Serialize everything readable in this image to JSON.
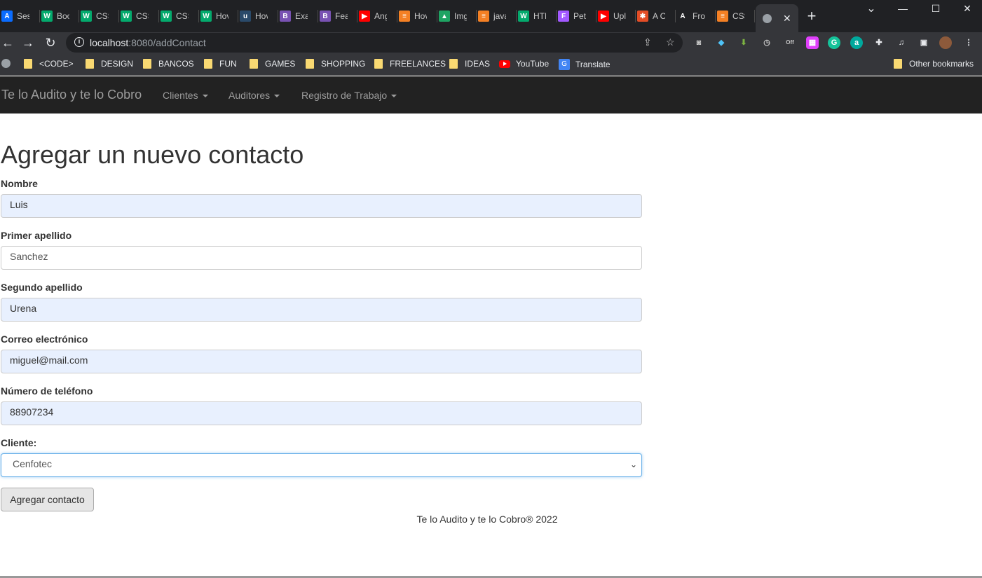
{
  "browser": {
    "tabs": [
      {
        "title": "Ses",
        "icon": "A",
        "color": "#0a6cff"
      },
      {
        "title": "Boo",
        "icon": "W",
        "color": "#04aa6d"
      },
      {
        "title": "CSS",
        "icon": "W",
        "color": "#04aa6d"
      },
      {
        "title": "CSS",
        "icon": "W",
        "color": "#04aa6d"
      },
      {
        "title": "CSS",
        "icon": "W",
        "color": "#04aa6d"
      },
      {
        "title": "Hov",
        "icon": "W",
        "color": "#04aa6d"
      },
      {
        "title": "Hov",
        "icon": "u",
        "color": "#2a4a6a"
      },
      {
        "title": "Exa",
        "icon": "B",
        "color": "#7952b3"
      },
      {
        "title": "Fea",
        "icon": "B",
        "color": "#7952b3"
      },
      {
        "title": "Ang",
        "icon": "▶",
        "color": "#ff0000"
      },
      {
        "title": "Hov",
        "icon": "≡",
        "color": "#f48024"
      },
      {
        "title": "Img",
        "icon": "▲",
        "color": "#1fa463"
      },
      {
        "title": "java",
        "icon": "≡",
        "color": "#f48024"
      },
      {
        "title": "HTM",
        "icon": "W",
        "color": "#04aa6d"
      },
      {
        "title": "Pet",
        "icon": "F",
        "color": "#a259ff"
      },
      {
        "title": "Upl",
        "icon": "▶",
        "color": "#ff0000"
      },
      {
        "title": "A C",
        "icon": "✱",
        "color": "#e44d26"
      },
      {
        "title": "Fro",
        "icon": "A",
        "color": "#202124"
      },
      {
        "title": "CSS",
        "icon": "≡",
        "color": "#f48024"
      }
    ],
    "new_tab_label": "+",
    "window_controls": {
      "minimize": "—",
      "maximize": "☐",
      "close": "✕",
      "dropdown": "⌄"
    },
    "address": {
      "host": "localhost",
      "rest": ":8080/addContact"
    },
    "bookmarks": [
      {
        "label": "<CODE>",
        "type": "folder"
      },
      {
        "label": "DESIGN",
        "type": "folder"
      },
      {
        "label": "BANCOS",
        "type": "folder"
      },
      {
        "label": "FUN",
        "type": "folder"
      },
      {
        "label": "GAMES",
        "type": "folder"
      },
      {
        "label": "SHOPPING",
        "type": "folder"
      },
      {
        "label": "FREELANCES",
        "type": "folder"
      },
      {
        "label": "IDEAS",
        "type": "folder"
      },
      {
        "label": "YouTube",
        "type": "youtube"
      },
      {
        "label": "Translate",
        "type": "translate"
      }
    ],
    "other_bookmarks": "Other bookmarks"
  },
  "navbar": {
    "brand": "Te lo Audito y te lo Cobro",
    "menus": [
      "Clientes",
      "Auditores",
      "Registro de Trabajo"
    ]
  },
  "page": {
    "title": "Agregar un nuevo contacto",
    "fields": [
      {
        "label": "Nombre",
        "value": "Luis"
      },
      {
        "label": "Primer apellido",
        "value": "Sanchez"
      },
      {
        "label": "Segundo apellido",
        "value": "Urena"
      },
      {
        "label": "Correo electrónico",
        "value": "miguel@mail.com"
      },
      {
        "label": "Número de teléfono",
        "value": "88907234"
      }
    ],
    "client_label": "Cliente:",
    "client_value": "Cenfotec",
    "submit_label": "Agregar contacto",
    "footer": "Te lo Audito y te lo Cobro® 2022"
  }
}
